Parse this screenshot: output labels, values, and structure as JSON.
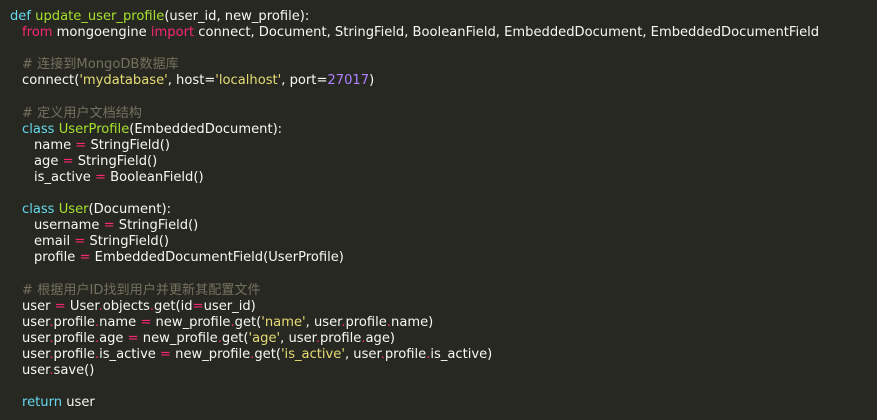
{
  "code": {
    "l1_def": "def",
    "l1_fname": "update_user_profile",
    "l1_rest": "(user_id, new_profile):",
    "l2_from": "from",
    "l2_module": " mongoengine ",
    "l2_import": "import",
    "l2_rest": " connect, Document, StringField, BooleanField, EmbeddedDocument, EmbeddedDocumentField",
    "l3_comment": "# 连接到MongoDB数据库",
    "l4_a": "connect(",
    "l4_str1": "'mydatabase'",
    "l4_b": ", host=",
    "l4_str2": "'localhost'",
    "l4_c": ", port=",
    "l4_num": "27017",
    "l4_d": ")",
    "l5_comment": "# 定义用户文档结构",
    "l6_class": "class",
    "l6_name": "UserProfile",
    "l6_rest": "(EmbeddedDocument):",
    "l7_a": "name ",
    "l7_eq": "=",
    "l7_b": " StringField()",
    "l8_a": "age ",
    "l8_eq": "=",
    "l8_b": " StringField()",
    "l9_a": "is_active ",
    "l9_eq": "=",
    "l9_b": " BooleanField()",
    "l10_class": "class",
    "l10_name": "User",
    "l10_rest": "(Document):",
    "l11_a": "username ",
    "l11_eq": "=",
    "l11_b": " StringField()",
    "l12_a": "email ",
    "l12_eq": "=",
    "l12_b": " StringField()",
    "l13_a": "profile ",
    "l13_eq": "=",
    "l13_b": " EmbeddedDocumentField(UserProfile)",
    "l14_comment": "# 根据用户ID找到用户并更新其配置文件",
    "l15_a": "user ",
    "l15_eq": "=",
    "l15_b": " User",
    "l15_dot1": ".",
    "l15_c": "objects",
    "l15_dot2": ".",
    "l15_d": "get(id",
    "l15_eq2": "=",
    "l15_e": "user_id)",
    "l16_a": "user",
    "l16_dot1": ".",
    "l16_b": "profile",
    "l16_dot2": ".",
    "l16_c": "name ",
    "l16_eq": "=",
    "l16_d": " new_profile",
    "l16_dot3": ".",
    "l16_e": "get(",
    "l16_str": "'name'",
    "l16_f": ", user",
    "l16_dot4": ".",
    "l16_g": "profile",
    "l16_dot5": ".",
    "l16_h": "name)",
    "l17_a": "user",
    "l17_dot1": ".",
    "l17_b": "profile",
    "l17_dot2": ".",
    "l17_c": "age ",
    "l17_eq": "=",
    "l17_d": " new_profile",
    "l17_dot3": ".",
    "l17_e": "get(",
    "l17_str": "'age'",
    "l17_f": ", user",
    "l17_dot4": ".",
    "l17_g": "profile",
    "l17_dot5": ".",
    "l17_h": "age)",
    "l18_a": "user",
    "l18_dot1": ".",
    "l18_b": "profile",
    "l18_dot2": ".",
    "l18_c": "is_active ",
    "l18_eq": "=",
    "l18_d": " new_profile",
    "l18_dot3": ".",
    "l18_e": "get(",
    "l18_str": "'is_active'",
    "l18_f": ", user",
    "l18_dot4": ".",
    "l18_g": "profile",
    "l18_dot5": ".",
    "l18_h": "is_active)",
    "l19_a": "user",
    "l19_dot": ".",
    "l19_b": "save()",
    "l20_return": "return",
    "l20_rest": " user"
  },
  "colors": {
    "background": "#272822",
    "text": "#f8f8f2",
    "keyword": "#66d9ef",
    "import": "#f92672",
    "function": "#a6e22e",
    "string": "#e6db74",
    "number": "#ae81ff",
    "comment": "#75715e"
  }
}
